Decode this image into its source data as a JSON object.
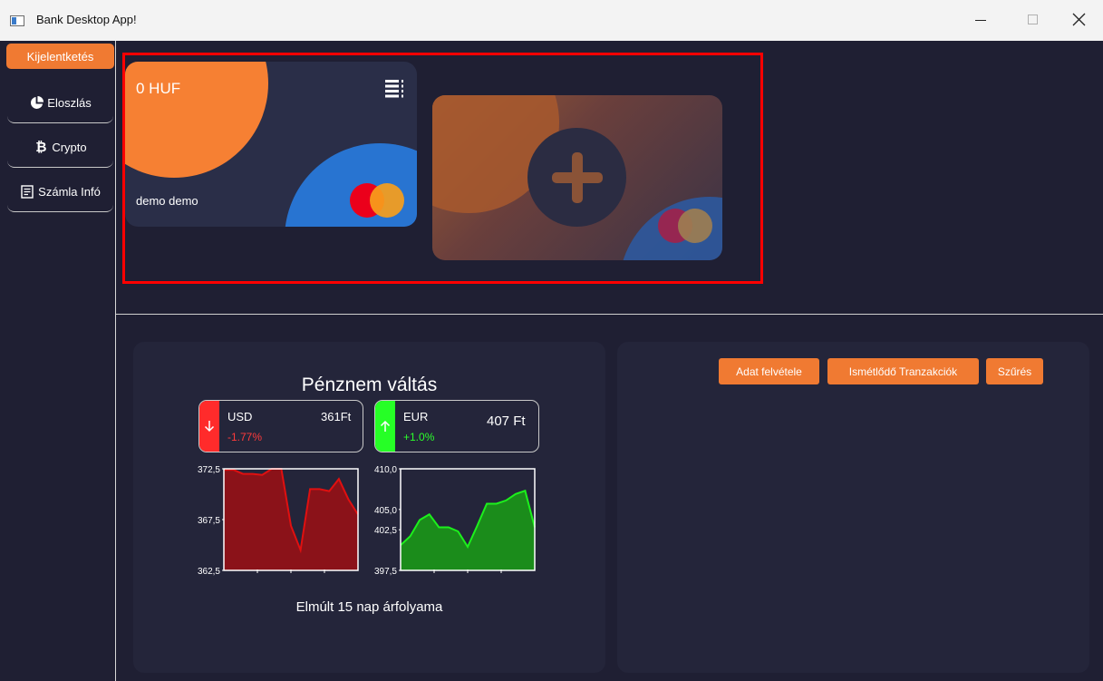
{
  "window": {
    "title": "Bank Desktop App!"
  },
  "sidebar": {
    "logout_label": "Kijelentketés",
    "items": [
      {
        "label": "Eloszlás",
        "icon": "pie-chart-icon"
      },
      {
        "label": "Crypto",
        "icon": "bitcoin-icon"
      },
      {
        "label": "Számla Infó",
        "icon": "document-icon"
      }
    ]
  },
  "cards": {
    "main": {
      "balance": "0 HUF",
      "holder": "demo demo",
      "brand": "mastercard"
    },
    "add": {
      "icon": "plus-icon"
    }
  },
  "currency": {
    "title": "Pénznem váltás",
    "footer": "Elmúlt 15 nap árfolyama",
    "usd": {
      "code": "USD",
      "price": "361Ft",
      "change": "-1.77%",
      "trend": "down",
      "color": "#ff2b2b"
    },
    "eur": {
      "code": "EUR",
      "price": "407 Ft",
      "change": "+1.0%",
      "trend": "up",
      "color": "#26ff26"
    }
  },
  "actions": {
    "add_data": "Adat felvétele",
    "recurring": "Ismétlődő Tranzakciók",
    "filter": "Szűrés"
  },
  "colors": {
    "accent": "#f07a32",
    "background": "#1f1f33",
    "panel": "#24253a",
    "selection": "#ff0000"
  },
  "chart_data": [
    {
      "type": "area",
      "series": [
        {
          "name": "USD",
          "values": [
            372.4,
            372.4,
            372.0,
            372.0,
            371.9,
            372.5,
            372.5,
            366.9,
            364.5,
            370.5,
            370.5,
            370.3,
            371.5,
            369.5,
            368.0
          ]
        }
      ],
      "ylim": [
        362.5,
        372.5
      ],
      "yticks": [
        "372,5",
        "367,5",
        "362,5"
      ],
      "color": "#e01010",
      "fill": "#8b1219"
    },
    {
      "type": "area",
      "series": [
        {
          "name": "EUR",
          "values": [
            400.6,
            401.7,
            403.7,
            404.4,
            402.8,
            402.8,
            402.3,
            400.4,
            403.0,
            405.7,
            405.7,
            406.1,
            406.9,
            407.3,
            402.8
          ]
        }
      ],
      "ylim": [
        397.5,
        410.0
      ],
      "yticks": [
        "410,0",
        "405,0",
        "402,5",
        "397,5"
      ],
      "color": "#1cf01c",
      "fill": "#1b8c1b"
    }
  ]
}
